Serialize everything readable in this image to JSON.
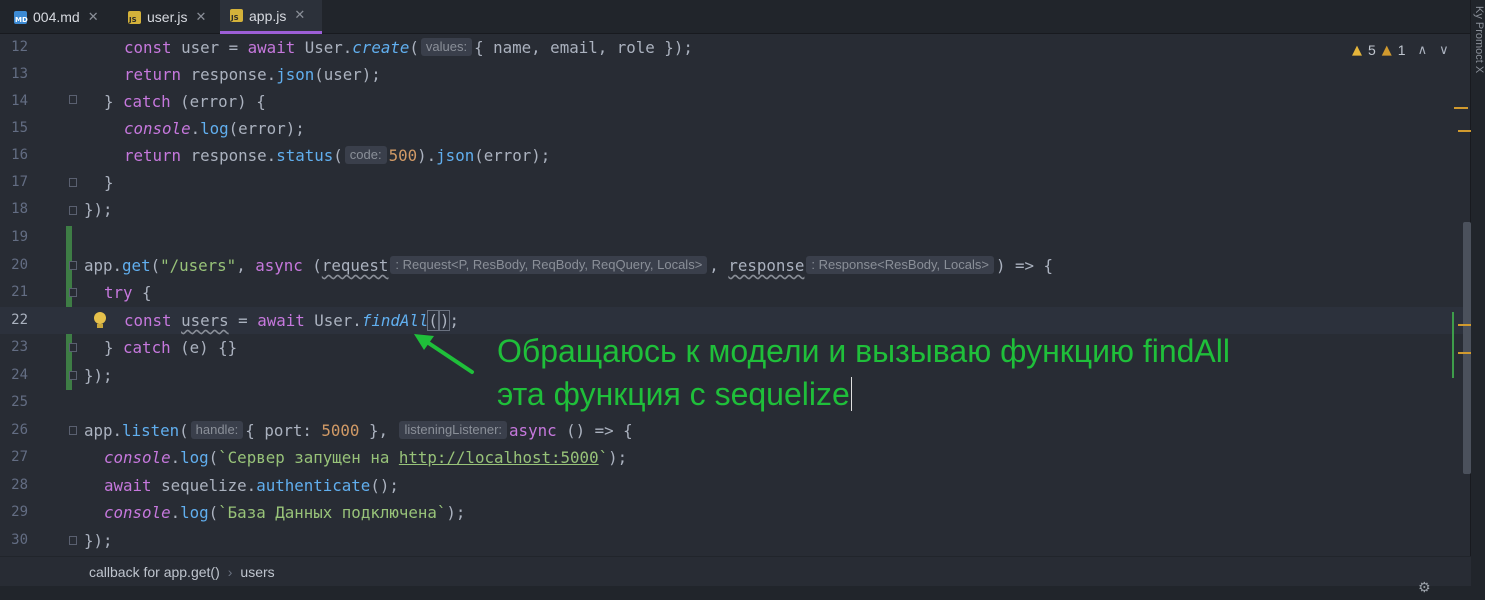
{
  "tabs": [
    {
      "name": "004.md",
      "icon": "md-file-icon",
      "badge": "MD"
    },
    {
      "name": "user.js",
      "icon": "js-file-icon",
      "badge": "JS"
    },
    {
      "name": "app.js",
      "icon": "js-file-icon",
      "badge": "JS",
      "active": true
    }
  ],
  "close_glyph": "✕",
  "side_panel_label": "Ky Promoct X",
  "indicators": {
    "warnings": "5",
    "weak_warnings": "1"
  },
  "lines": {
    "n12": "12",
    "n13": "13",
    "n14": "14",
    "n15": "15",
    "n16": "16",
    "n17": "17",
    "n18": "18",
    "n19": "19",
    "n20": "20",
    "n21": "21",
    "n22": "22",
    "n23": "23",
    "n24": "24",
    "n25": "25",
    "n26": "26",
    "n27": "27",
    "n28": "28",
    "n29": "29",
    "n30": "30"
  },
  "hints": {
    "values": "values:",
    "code": "code:",
    "request_type": ": Request<P, ResBody, ReqBody, ReqQuery, Locals>",
    "response_type": ": Response<ResBody, Locals>",
    "handle": "handle:",
    "listening": "listeningListener:"
  },
  "code": {
    "route": "\"/users\"",
    "status_code": "500",
    "port": "5000",
    "log1_prefix": "`Сервер запущен на ",
    "log1_url": "http://localhost:5000",
    "log1_suffix": "`",
    "log2": "`База Данных подключена`"
  },
  "annotation": {
    "line1": "Обращаюсь к модели и вызываю функцию findAll",
    "line2": "эта функция с sequelize"
  },
  "breadcrumbs": [
    "callback for app.get()",
    "users"
  ],
  "colors": {
    "keyword": "#c678dd",
    "function": "#61afef",
    "string": "#98c379",
    "number": "#d19a66",
    "annotation": "#1fbf3a",
    "active_tab": "#9c5ed6"
  }
}
